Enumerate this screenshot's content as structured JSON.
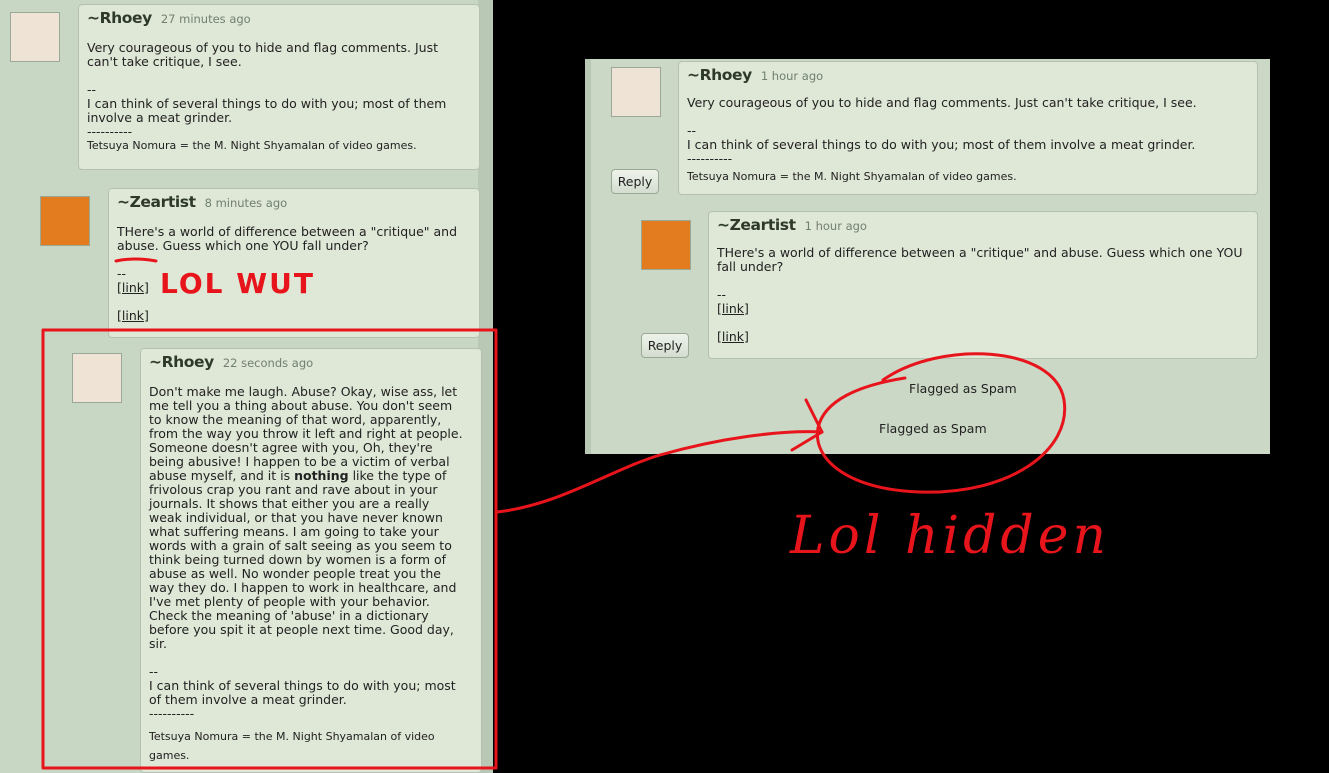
{
  "left_panel": {
    "comment1": {
      "username": "~Rhoey",
      "time": "27 minutes ago",
      "lines": [
        "Very courageous of you to hide and flag comments. Just",
        "can't take critique, I see."
      ],
      "sep": "--",
      "sig_lines": [
        "I can think of several things to do with you; most of them",
        "involve a meat grinder."
      ],
      "dash": "----------",
      "footer": "Tetsuya Nomura = the M. Night Shyamalan of video games."
    },
    "comment2": {
      "username": "~Zeartist",
      "time": "8 minutes ago",
      "line1": "THere's a world of difference between a \"critique\" and",
      "line2_underlined": "abuse",
      "line2_rest": ". Guess which one YOU fall under?",
      "sep": "--",
      "link1": "[link]",
      "link2": "[link]"
    },
    "comment3": {
      "username": "~Rhoey",
      "time": "22 seconds ago",
      "body_lines": [
        "Don't make me laugh. Abuse? Okay, wise ass, let",
        "me tell you a thing about abuse. You don't seem",
        "to know the meaning of that word, apparently,",
        "from the way you throw it left and right at people.",
        "Someone doesn't agree with you, Oh, they're",
        "being abusive! I happen to be a victim of verbal",
        "abuse myself, and it is ",
        "journals. It shows that either you are a really",
        "weak individual, or that you have never known",
        "what suffering means. I am going to take your",
        "words with a grain of salt seeing as you seem to",
        "think being turned down by women is a form of",
        "abuse as well. No wonder people treat you the",
        "way they do. I happen to work in healthcare, and",
        "I've met plenty of people with your behavior.",
        "Check the meaning of 'abuse' in a dictionary",
        "before you spit it at people next time. Good day,",
        "sir."
      ],
      "bold_word": "nothing",
      "after_bold": " like the type of",
      "line_frivolous": "frivolous crap you rant and rave about in your",
      "sep": "--",
      "sig_lines": [
        "I can think of several things to do with you; most",
        "of them involve a meat grinder."
      ],
      "dash": "----------",
      "footer_lines": [
        "Tetsuya Nomura = the M. Night Shyamalan of video",
        "games."
      ]
    }
  },
  "right_panel": {
    "comment1": {
      "username": "~Rhoey",
      "time": "1 hour ago",
      "line": "Very courageous of you to hide and flag comments. Just can't take critique, I see.",
      "sep": "--",
      "sig": "I can think of several things to do with you; most of them involve a meat grinder.",
      "dash": "----------",
      "footer": "Tetsuya Nomura = the M. Night Shyamalan of video games.",
      "reply": "Reply"
    },
    "comment2": {
      "username": "~Zeartist",
      "time": "1 hour ago",
      "lines": [
        "THere's a world of difference between a \"critique\" and abuse. Guess which one YOU",
        "fall under?"
      ],
      "sep": "--",
      "link1": "[link]",
      "link2": "[link]",
      "reply": "Reply"
    },
    "flag1": "Flagged as Spam",
    "flag2": "Flagged as Spam"
  },
  "annotations": {
    "lol_wut": "LOL WUT",
    "lol_hidden": "Lol hidden",
    "ink_color": "#e8141c"
  }
}
